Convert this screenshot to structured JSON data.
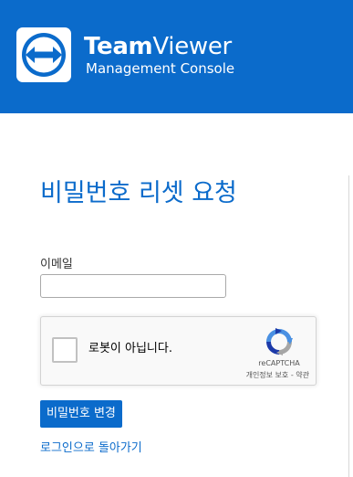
{
  "header": {
    "brand_bold": "Team",
    "brand_light": "Viewer",
    "subtitle": "Management Console",
    "logo_icon": "teamviewer-logo-icon",
    "background_color": "#0b6bcb"
  },
  "main": {
    "title": "비밀번호 리셋 요청",
    "email_label": "이메일",
    "email_value": "",
    "captcha": {
      "label": "로봇이 아닙니다.",
      "brand": "reCAPTCHA",
      "privacy_link": "개인정보 보호",
      "separator": " - ",
      "terms_link": "약관",
      "logo_icon": "recaptcha-icon"
    },
    "submit_label": "비밀번호 변경",
    "back_link": "로그인으로 돌아가기"
  },
  "colors": {
    "accent": "#0b6bcb",
    "text": "#333333"
  }
}
